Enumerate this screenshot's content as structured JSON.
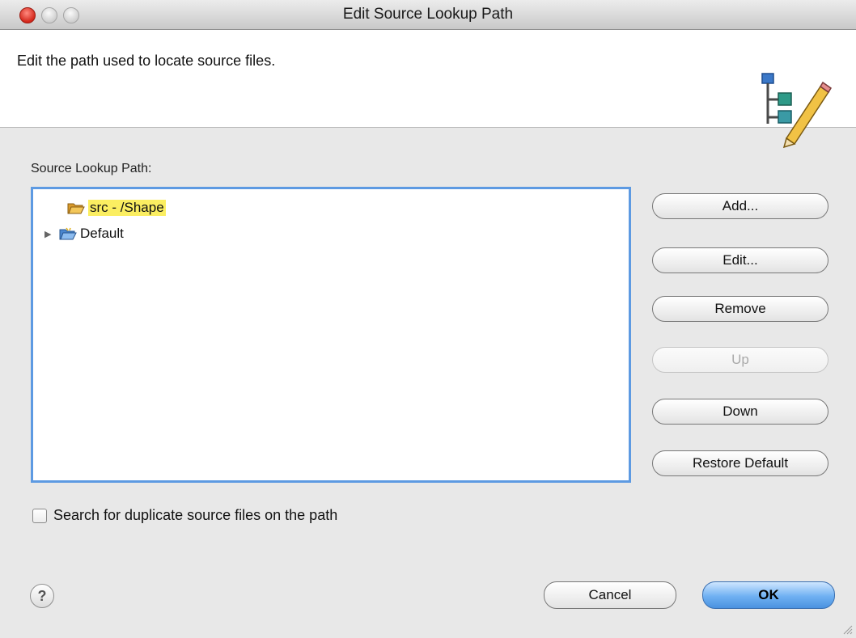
{
  "window": {
    "title": "Edit Source Lookup Path"
  },
  "header": {
    "description": "Edit the path used to locate source files.",
    "icon": "source-path-edit-icon"
  },
  "lookup": {
    "label": "Source Lookup Path:",
    "items": [
      {
        "label": "src - /Shape",
        "icon": "folder-open-icon",
        "selected": true,
        "highlight_color": "#fbee61"
      },
      {
        "label": "Default",
        "icon": "folder-icon",
        "expandable": true
      }
    ]
  },
  "buttons": {
    "add": "Add...",
    "edit": "Edit...",
    "remove": "Remove",
    "up": "Up",
    "down": "Down",
    "restore": "Restore Default"
  },
  "options": {
    "duplicates_label": "Search for duplicate source files on the path",
    "duplicates_checked": false
  },
  "footer": {
    "help": "?",
    "cancel": "Cancel",
    "ok": "OK"
  },
  "colors": {
    "accent": "#5d9ae2",
    "selection_highlight": "#fbee61",
    "close_button": "#d3261a"
  }
}
